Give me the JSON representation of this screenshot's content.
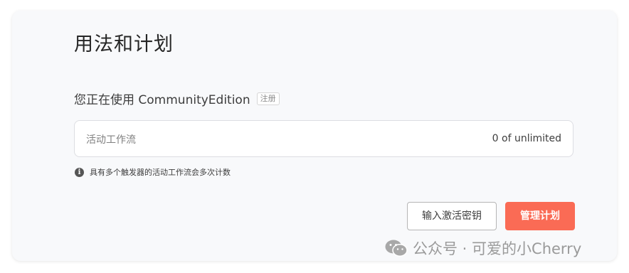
{
  "page": {
    "title": "用法和计划"
  },
  "edition": {
    "text": "您正在使用 CommunityEdition",
    "register_badge": "注册"
  },
  "active_workflows": {
    "label": "活动工作流",
    "value": "0 of unlimited"
  },
  "info": {
    "icon": "info-icon",
    "text": "具有多个触发器的活动工作流会多次计数"
  },
  "actions": {
    "enter_activation_key": "输入激活密钥",
    "manage_plan": "管理计划"
  },
  "colors": {
    "accent": "#fa6b55",
    "panel_bg": "#f8f9fb"
  },
  "watermark": {
    "icon": "wechat-icon",
    "text": "公众号 · 可爱的小Cherry"
  }
}
